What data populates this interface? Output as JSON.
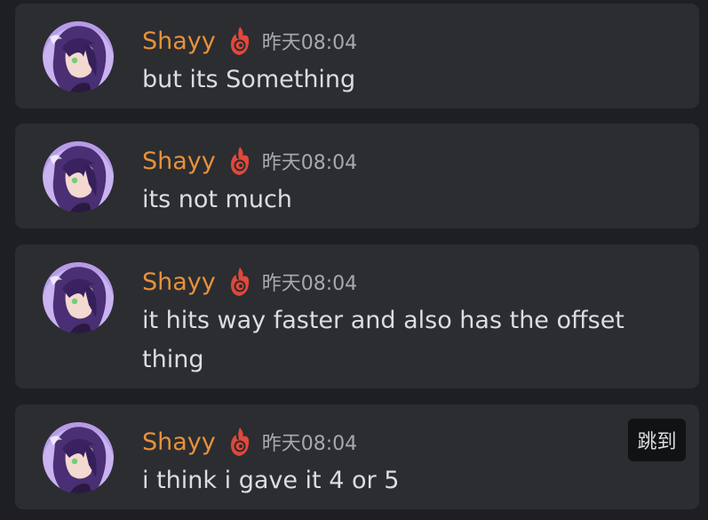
{
  "messages": [
    {
      "username": "Shayy",
      "timestamp": "昨天08:04",
      "text": "but its Something"
    },
    {
      "username": "Shayy",
      "timestamp": "昨天08:04",
      "text": "its not much"
    },
    {
      "username": "Shayy",
      "timestamp": "昨天08:04",
      "text": "it hits way faster and also has the offset thing"
    },
    {
      "username": "Shayy",
      "timestamp": "昨天08:04",
      "text": "i think i gave it 4 or 5"
    }
  ],
  "jump_button": {
    "label": "跳到"
  },
  "colors": {
    "background": "#1e1f22",
    "card": "#2b2d31",
    "username": "#e8913a",
    "timestamp": "#a7a9ae",
    "text": "#dcdde1",
    "role_icon": "#e0483a"
  }
}
